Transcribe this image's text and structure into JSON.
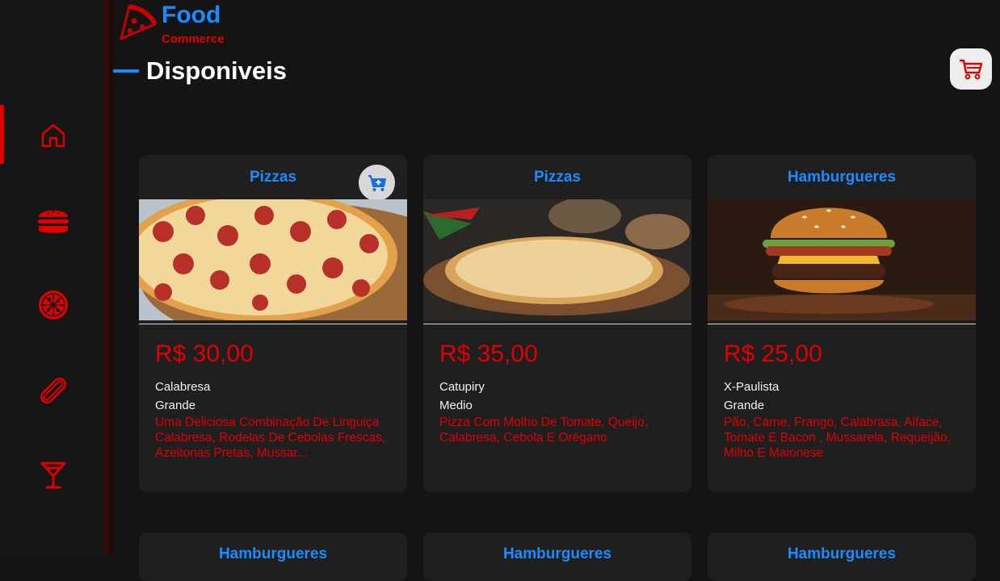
{
  "brand": {
    "title": "Food",
    "subtitle": "Commerce"
  },
  "section": {
    "title": "Disponiveis"
  },
  "sidebar": {
    "items": [
      {
        "icon": "home-icon",
        "active": true
      },
      {
        "icon": "burger-icon",
        "active": false
      },
      {
        "icon": "pizza-icon",
        "active": false
      },
      {
        "icon": "hotdog-icon",
        "active": false
      },
      {
        "icon": "cocktail-icon",
        "active": false
      }
    ]
  },
  "colors": {
    "accent_blue": "#1a8cff",
    "accent_red": "#e00000",
    "background": "#141414",
    "card": "#1f1f20"
  },
  "products": [
    {
      "category": "Pizzas",
      "price": "R$ 30,00",
      "name": "Calabresa",
      "size": "Grande",
      "description": "Uma Deliciosa Combinação De Linguiça Calabresa, Rodelas De Cebolas Frescas, Azeitonas Pretas, Mussar..."
    },
    {
      "category": "Pizzas",
      "price": "R$ 35,00",
      "name": "Catupiry",
      "size": "Medio",
      "description": "Pizza Com Molho De Tomate, Queijo, Calabresa, Cebola E Orégano"
    },
    {
      "category": "Hamburgueres",
      "price": "R$ 25,00",
      "name": "X-Paulista",
      "size": "Grande",
      "description": "Pão, Carne, Frango, Calabrasa, Alface, Tomate E Bacon , Mussarela, Requeijão, Milho E Maionese"
    },
    {
      "category": "Hamburgueres"
    },
    {
      "category": "Hamburgueres"
    },
    {
      "category": "Hamburgueres"
    }
  ]
}
